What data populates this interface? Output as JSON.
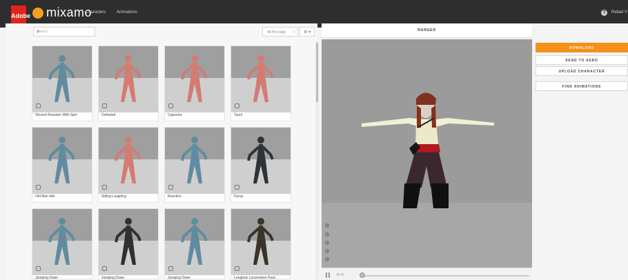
{
  "topbar": {
    "adobe_label": "Adobe",
    "logo": "mixamo",
    "nav": [
      "Characters",
      "Animations"
    ],
    "help_icon": "?",
    "user": "Rafael V"
  },
  "toolbar": {
    "search_placeholder": "Search",
    "per_page": "48 Per page",
    "gear_caret": "⚙ ▾"
  },
  "animations": [
    {
      "label": "Shoved Reaction With Spin",
      "color": "#5f8ca0"
    },
    {
      "label": "Defeated",
      "color": "#d47b73"
    },
    {
      "label": "Capoeira",
      "color": "#d47b73"
    },
    {
      "label": "Taunt",
      "color": "#d47b73"
    },
    {
      "label": "Old Man Idle",
      "color": "#5f8ca0"
    },
    {
      "label": "Sitting Laughing",
      "color": "#d47b73"
    },
    {
      "label": "Reaction",
      "color": "#5f8ca0"
    },
    {
      "label": "Dying",
      "color": "#2f3335"
    },
    {
      "label": "Jumping Down",
      "color": "#5f8ca0"
    },
    {
      "label": "Jumping Down",
      "color": "#303030"
    },
    {
      "label": "Jumping Down",
      "color": "#5f8ca0"
    },
    {
      "label": "Longbow Locomotion Pack",
      "color": "#3a3328"
    }
  ],
  "viewer": {
    "title": "RANGED",
    "time": "0 / 0",
    "progress": 0
  },
  "actions": {
    "download": "DOWNLOAD",
    "send": "SEND TO AERO",
    "upload": "UPLOAD CHARACTER",
    "find": "FIND ANIMATIONS"
  },
  "colors": {
    "accent": "#f59018",
    "topbar": "#2e2e2e",
    "viewer": "#9b9b9b"
  }
}
